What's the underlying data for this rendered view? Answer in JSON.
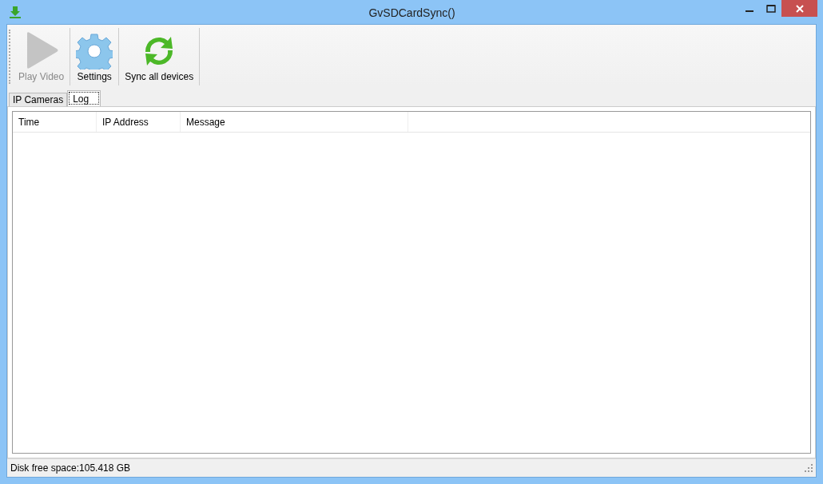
{
  "window": {
    "title": "GvSDCardSync()"
  },
  "toolbar": [
    {
      "label": "Play Video",
      "kind": "play",
      "disabled": true
    },
    {
      "label": "Settings",
      "kind": "settings",
      "disabled": false
    },
    {
      "label": "Sync all devices",
      "kind": "sync",
      "disabled": false
    }
  ],
  "tabs": [
    {
      "label": "IP Cameras",
      "selected": false
    },
    {
      "label": "Log",
      "selected": true
    }
  ],
  "table": {
    "columns": [
      "Time",
      "IP Address",
      "Message"
    ]
  },
  "status_bar": "Disk free space:105.418 GB"
}
